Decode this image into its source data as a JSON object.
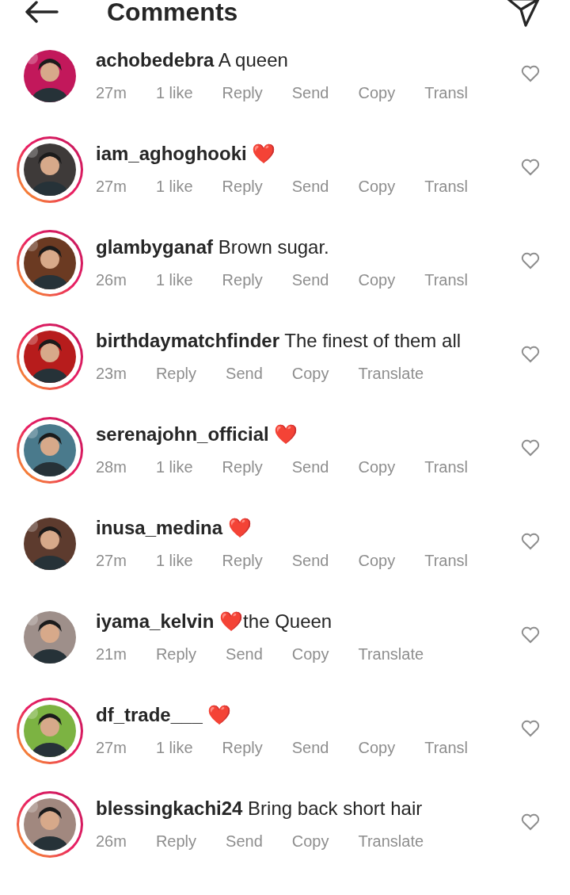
{
  "header": {
    "title": "Comments"
  },
  "comments": [
    {
      "user": "achobedebra",
      "text": "A queen",
      "story_ring": false,
      "meta": [
        "27m",
        "1 like",
        "Reply",
        "Send",
        "Copy",
        "Transl"
      ]
    },
    {
      "user": "iam_aghoghooki",
      "text": "❤️",
      "story_ring": true,
      "meta": [
        "27m",
        "1 like",
        "Reply",
        "Send",
        "Copy",
        "Transl"
      ]
    },
    {
      "user": "glambyganaf",
      "text": "Brown sugar.",
      "story_ring": true,
      "meta": [
        "26m",
        "1 like",
        "Reply",
        "Send",
        "Copy",
        "Transl"
      ]
    },
    {
      "user": "birthdaymatchfinder",
      "text": "The finest of them all",
      "story_ring": true,
      "meta": [
        "23m",
        "Reply",
        "Send",
        "Copy",
        "Translate"
      ]
    },
    {
      "user": "serenajohn_official",
      "text": "❤️",
      "story_ring": true,
      "meta": [
        "28m",
        "1 like",
        "Reply",
        "Send",
        "Copy",
        "Transl"
      ]
    },
    {
      "user": "inusa_medina",
      "text": "❤️",
      "story_ring": false,
      "meta": [
        "27m",
        "1 like",
        "Reply",
        "Send",
        "Copy",
        "Transl"
      ]
    },
    {
      "user": "iyama_kelvin",
      "text": "❤️the Queen",
      "story_ring": false,
      "meta": [
        "21m",
        "Reply",
        "Send",
        "Copy",
        "Translate"
      ]
    },
    {
      "user": "df_trade___",
      "text": "❤️",
      "story_ring": true,
      "meta": [
        "27m",
        "1 like",
        "Reply",
        "Send",
        "Copy",
        "Transl"
      ]
    },
    {
      "user": "blessingkachi24",
      "text": "Bring back short hair",
      "story_ring": true,
      "meta": [
        "26m",
        "Reply",
        "Send",
        "Copy",
        "Translate"
      ]
    }
  ]
}
